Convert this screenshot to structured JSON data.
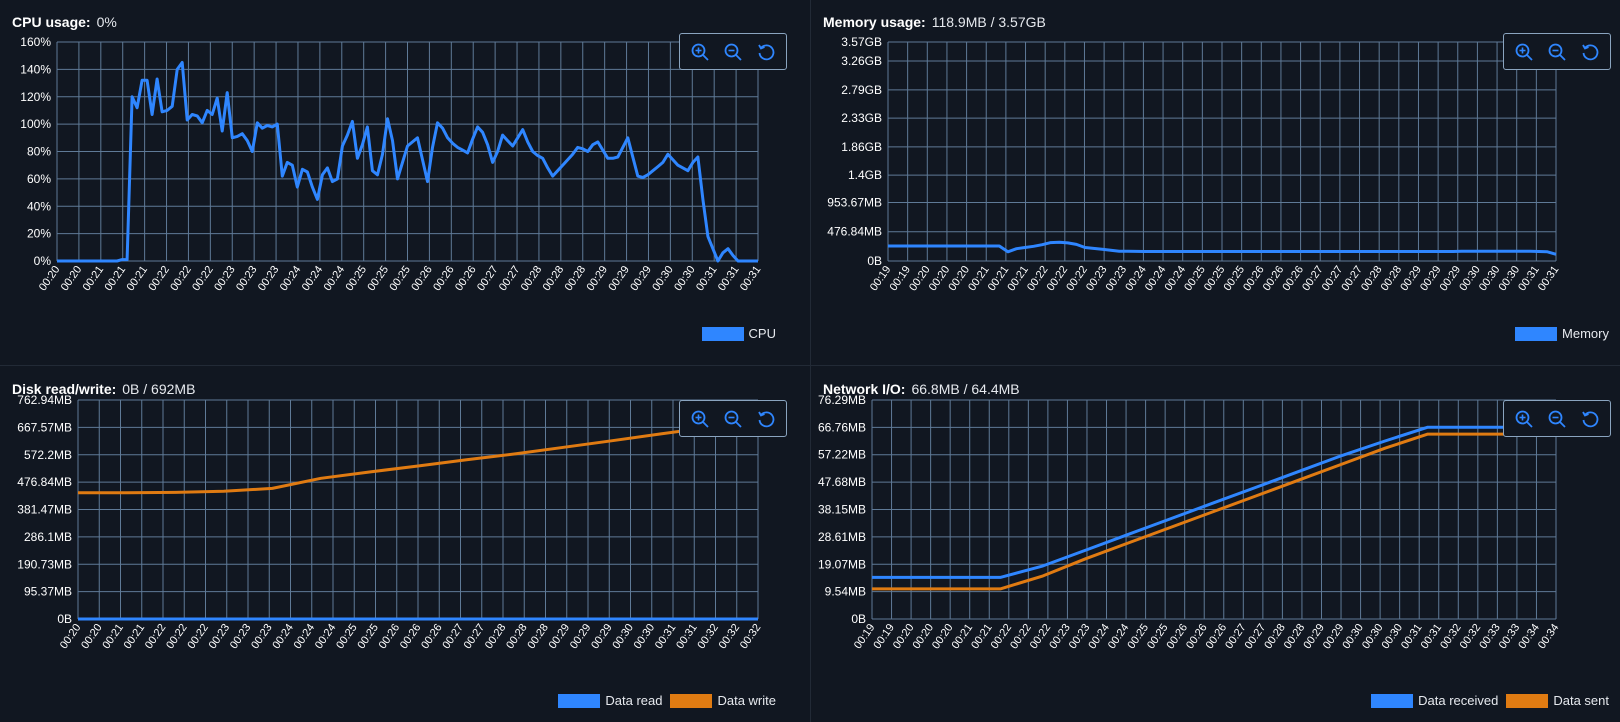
{
  "theme": {
    "background": "#111721",
    "grid": "#5f7a97",
    "blue": "#2f86ff",
    "orange": "#e07b12"
  },
  "toolbar": {
    "zoom_in_icon": "zoom-in-icon",
    "zoom_out_icon": "zoom-out-icon",
    "reset_icon": "reset-zoom-icon"
  },
  "panels": {
    "cpu": {
      "title": "CPU usage:",
      "value": "0%",
      "legend": [
        "CPU"
      ]
    },
    "memory": {
      "title": "Memory usage:",
      "value": "118.9MB / 3.57GB",
      "legend": [
        "Memory"
      ]
    },
    "disk": {
      "title": "Disk read/write:",
      "value": "0B / 692MB",
      "legend": [
        "Data read",
        "Data write"
      ]
    },
    "network": {
      "title": "Network I/O:",
      "value": "66.8MB / 64.4MB",
      "legend": [
        "Data received",
        "Data sent"
      ]
    }
  },
  "chart_data": [
    {
      "id": "cpu",
      "type": "line",
      "ylim": [
        0,
        160
      ],
      "y_ticks": [
        "0%",
        "20%",
        "40%",
        "60%",
        "80%",
        "100%",
        "120%",
        "140%",
        "160%"
      ],
      "x_ticks": [
        "00:20",
        "00:20",
        "00:21",
        "00:21",
        "00:21",
        "00:22",
        "00:22",
        "00:22",
        "00:23",
        "00:23",
        "00:23",
        "00:24",
        "00:24",
        "00:24",
        "00:25",
        "00:25",
        "00:25",
        "00:26",
        "00:26",
        "00:26",
        "00:27",
        "00:27",
        "00:28",
        "00:28",
        "00:28",
        "00:29",
        "00:29",
        "00:29",
        "00:30",
        "00:30",
        "00:31",
        "00:31",
        "00:31"
      ],
      "grid": true,
      "legend_position": "bottom-right",
      "series": [
        {
          "name": "CPU",
          "color": "#2f86ff",
          "values": [
            0,
            0,
            0,
            0,
            0,
            0,
            0,
            0,
            0,
            0,
            0,
            0,
            0,
            1,
            1,
            120,
            112,
            132,
            132,
            107,
            133,
            109,
            110,
            113,
            140,
            145,
            103,
            107,
            106,
            101,
            110,
            107,
            119,
            95,
            123,
            90,
            91,
            93,
            88,
            80,
            101,
            97,
            99,
            98,
            100,
            62,
            72,
            70,
            54,
            67,
            65,
            54,
            45,
            63,
            68,
            58,
            60,
            84,
            92,
            102,
            75,
            85,
            98,
            66,
            63,
            78,
            104,
            88,
            60,
            72,
            84,
            87,
            90,
            74,
            58,
            83,
            101,
            97,
            90,
            86,
            83,
            81,
            79,
            89,
            98,
            94,
            85,
            72,
            80,
            92,
            88,
            84,
            90,
            96,
            87,
            80,
            77,
            75,
            68,
            62,
            66,
            70,
            74,
            78,
            83,
            82,
            80,
            85,
            87,
            81,
            75,
            75,
            76,
            83,
            90,
            76,
            62,
            61,
            63,
            66,
            69,
            72,
            78,
            74,
            70,
            68,
            66,
            72,
            76,
            45,
            18,
            9,
            0,
            6,
            9,
            4,
            0,
            0,
            0,
            0,
            0
          ]
        }
      ]
    },
    {
      "id": "memory",
      "type": "line",
      "y_ticks": [
        "0B",
        "476.84MB",
        "953.67MB",
        "1.4GB",
        "1.86GB",
        "2.33GB",
        "2.79GB",
        "3.26GB",
        "3.57GB"
      ],
      "y_tick_values": [
        0,
        476.84,
        953.67,
        1400,
        1860,
        2330,
        2790,
        3260,
        3570
      ],
      "ylim": [
        0,
        3570
      ],
      "x_ticks": [
        "00:19",
        "00:19",
        "00:20",
        "00:20",
        "00:20",
        "00:21",
        "00:21",
        "00:21",
        "00:22",
        "00:22",
        "00:22",
        "00:23",
        "00:23",
        "00:24",
        "00:24",
        "00:24",
        "00:25",
        "00:25",
        "00:25",
        "00:26",
        "00:26",
        "00:26",
        "00:27",
        "00:27",
        "00:27",
        "00:28",
        "00:28",
        "00:29",
        "00:29",
        "00:29",
        "00:30",
        "00:30",
        "00:30",
        "00:31",
        "00:31"
      ],
      "grid": true,
      "legend_position": "bottom-right",
      "series": [
        {
          "name": "Memory",
          "color": "#2f86ff",
          "values": [
            245,
            245,
            245,
            245,
            245,
            245,
            245,
            245,
            245,
            245,
            245,
            245,
            245,
            245,
            150,
            200,
            220,
            240,
            265,
            300,
            305,
            295,
            270,
            220,
            205,
            190,
            175,
            160,
            158,
            156,
            155,
            155,
            155,
            155,
            155,
            155,
            155,
            155,
            155,
            155,
            155,
            155,
            155,
            155,
            155,
            155,
            155,
            155,
            155,
            155,
            155,
            155,
            155,
            155,
            155,
            155,
            155,
            155,
            155,
            155,
            155,
            155,
            155,
            155,
            155,
            155,
            155,
            160,
            160,
            160,
            160,
            160,
            160,
            160,
            160,
            160,
            155,
            150,
            110
          ]
        }
      ]
    },
    {
      "id": "disk",
      "type": "line",
      "y_ticks": [
        "0B",
        "95.37MB",
        "190.73MB",
        "286.1MB",
        "381.47MB",
        "476.84MB",
        "572.2MB",
        "667.57MB",
        "762.94MB"
      ],
      "y_tick_values": [
        0,
        95.37,
        190.73,
        286.1,
        381.47,
        476.84,
        572.2,
        667.57,
        762.94
      ],
      "ylim": [
        0,
        762.94
      ],
      "x_ticks": [
        "00:20",
        "00:20",
        "00:21",
        "00:21",
        "00:22",
        "00:22",
        "00:22",
        "00:23",
        "00:23",
        "00:23",
        "00:24",
        "00:24",
        "00:24",
        "00:25",
        "00:25",
        "00:26",
        "00:26",
        "00:26",
        "00:27",
        "00:27",
        "00:28",
        "00:28",
        "00:28",
        "00:29",
        "00:29",
        "00:29",
        "00:30",
        "00:30",
        "00:31",
        "00:31",
        "00:32",
        "00:32",
        "00:32"
      ],
      "grid": true,
      "legend_position": "bottom-right",
      "series": [
        {
          "name": "Data read",
          "color": "#2f86ff",
          "values": [
            0,
            0,
            0,
            0,
            0,
            0,
            0,
            0,
            0,
            0,
            0,
            0,
            0,
            0
          ]
        },
        {
          "name": "Data write",
          "color": "#e07b12",
          "values": [
            440,
            440,
            441,
            445,
            455,
            490,
            512,
            533,
            555,
            575,
            598,
            621,
            645,
            668,
            692
          ]
        }
      ]
    },
    {
      "id": "network",
      "type": "line",
      "y_ticks": [
        "0B",
        "9.54MB",
        "19.07MB",
        "28.61MB",
        "38.15MB",
        "47.68MB",
        "57.22MB",
        "66.76MB",
        "76.29MB"
      ],
      "y_tick_values": [
        0,
        9.54,
        19.07,
        28.61,
        38.15,
        47.68,
        57.22,
        66.76,
        76.29
      ],
      "ylim": [
        0,
        76.29
      ],
      "x_ticks": [
        "00:19",
        "00:19",
        "00:20",
        "00:20",
        "00:20",
        "00:21",
        "00:21",
        "00:22",
        "00:22",
        "00:22",
        "00:23",
        "00:23",
        "00:24",
        "00:24",
        "00:25",
        "00:25",
        "00:26",
        "00:26",
        "00:26",
        "00:27",
        "00:27",
        "00:28",
        "00:28",
        "00:29",
        "00:29",
        "00:30",
        "00:30",
        "00:30",
        "00:31",
        "00:31",
        "00:32",
        "00:32",
        "00:33",
        "00:33",
        "00:34",
        "00:34"
      ],
      "grid": true,
      "legend_position": "bottom-right",
      "series": [
        {
          "name": "Data received",
          "color": "#2f86ff",
          "values": [
            14.5,
            14.5,
            14.5,
            14.5,
            18.5,
            24,
            29.5,
            35,
            40.5,
            46,
            51.5,
            57,
            62,
            66.8,
            66.8,
            66.8,
            66.8
          ]
        },
        {
          "name": "Data sent",
          "color": "#e07b12",
          "values": [
            10.5,
            10.5,
            10.5,
            10.5,
            15,
            21,
            26.5,
            32,
            37.5,
            43,
            48.5,
            54,
            59.5,
            64.4,
            64.4,
            64.4,
            64.4
          ]
        }
      ]
    }
  ]
}
